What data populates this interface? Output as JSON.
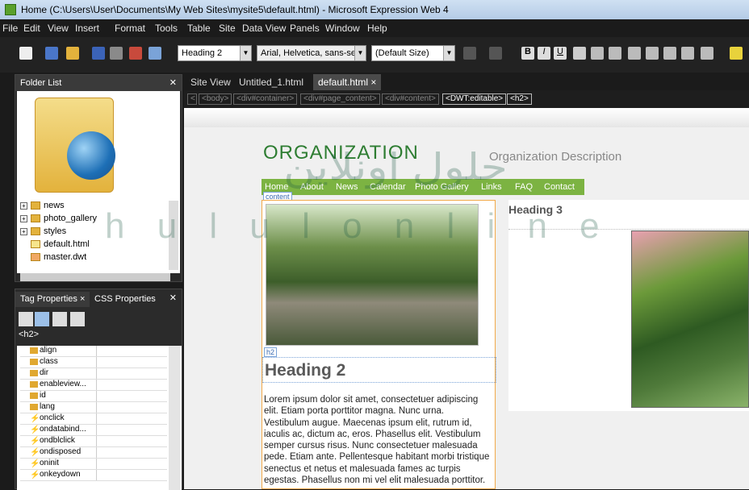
{
  "window": {
    "title": "Home (C:\\Users\\User\\Documents\\My Web Sites\\mysite5\\default.html) - Microsoft Expression Web 4"
  },
  "menu": [
    "File",
    "Edit",
    "View",
    "Insert",
    "Format",
    "Tools",
    "Table",
    "Site",
    "Data View",
    "Panels",
    "Window",
    "Help"
  ],
  "toolbar": {
    "style": "Heading 2",
    "font": "Arial, Helvetica, sans-seri",
    "size": "(Default Size)"
  },
  "folder_list": {
    "title": "Folder List",
    "items": [
      "news",
      "photo_gallery",
      "styles",
      "default.html",
      "master.dwt"
    ]
  },
  "tag_properties": {
    "tabs": [
      "Tag Properties",
      "CSS Properties"
    ],
    "tag": "<h2>",
    "attributes": [
      "align",
      "class",
      "dir",
      "enableview...",
      "id",
      "lang"
    ],
    "events": [
      "onclick",
      "ondatabind...",
      "ondblclick",
      "ondisposed",
      "oninit",
      "onkeydown"
    ]
  },
  "editor": {
    "tabs": [
      "Site View",
      "Untitled_1.html",
      "default.html"
    ],
    "breadcrumbs": [
      "<body>",
      "<div#container>",
      "<div#page_content>",
      "<div#content>",
      "<DWT:editable>",
      "<h2>"
    ]
  },
  "page": {
    "org_name": "ORGANIZATION",
    "org_desc": "Organization Description",
    "nav": [
      "Home",
      "About",
      "News",
      "Calendar",
      "Photo Gallery",
      "Links",
      "FAQ",
      "Contact"
    ],
    "content_label": "content",
    "h2_label": "h2",
    "heading2": "Heading 2",
    "heading3": "Heading 3",
    "body_lines": [
      "Lorem ipsum dolor sit amet, consectetuer adipiscing",
      "elit. Etiam porta porttitor magna. Nunc urna.",
      "Vestibulum augue. Maecenas ipsum elit, rutrum id,",
      "iaculis ac, dictum ac, eros. Phasellus elit. Vestibulum",
      "semper cursus risus. Nunc consectetuer malesuada",
      "pede. Etiam ante. Pellentesque habitant morbi tristique",
      "senectus et netus et malesuada fames ac turpis",
      "egestas. Phasellus non mi vel elit malesuada porttitor."
    ]
  },
  "watermark": {
    "line1": "حلول اونلاين",
    "line2": "h u l u l o n l i n e"
  }
}
